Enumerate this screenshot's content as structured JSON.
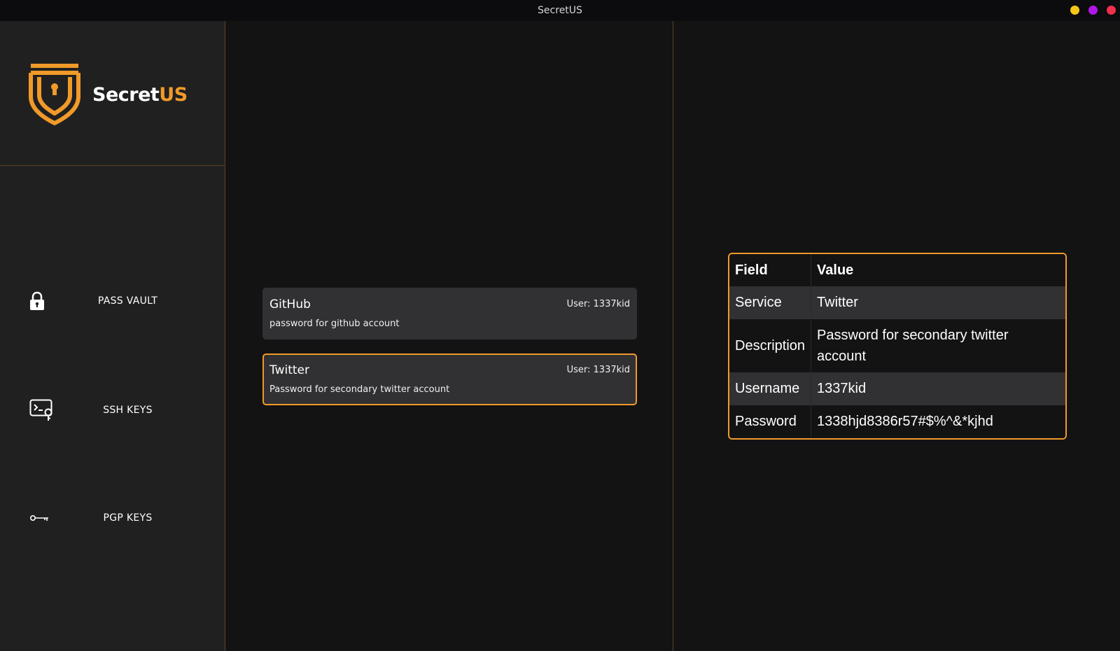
{
  "window": {
    "title": "SecretUS",
    "controls": [
      {
        "name": "minimize",
        "color": "#f5c518"
      },
      {
        "name": "maximize",
        "color": "#b116e8"
      },
      {
        "name": "close",
        "color": "#f0304a"
      }
    ]
  },
  "brand": {
    "name_white": "Secret",
    "name_orange": "US",
    "accent": "#f09a2a"
  },
  "sidebar": {
    "items": [
      {
        "label": "PASS VAULT",
        "icon": "lock-icon"
      },
      {
        "label": "SSH KEYS",
        "icon": "terminal-key-icon"
      },
      {
        "label": "PGP KEYS",
        "icon": "key-icon"
      }
    ]
  },
  "entries": [
    {
      "title": "GitHub",
      "user": "User: 1337kid",
      "description": "password for github account",
      "selected": false
    },
    {
      "title": "Twitter",
      "user": "User: 1337kid",
      "description": "Password for secondary twitter account",
      "selected": true
    }
  ],
  "detail": {
    "headers": [
      "Field",
      "Value"
    ],
    "rows": [
      {
        "field": "Service",
        "value": "Twitter"
      },
      {
        "field": "Description",
        "value": "Password for secondary twitter account"
      },
      {
        "field": "Username",
        "value": "1337kid"
      },
      {
        "field": "Password",
        "value": "1338hjd8386r57#$%^&*kjhd"
      }
    ]
  }
}
